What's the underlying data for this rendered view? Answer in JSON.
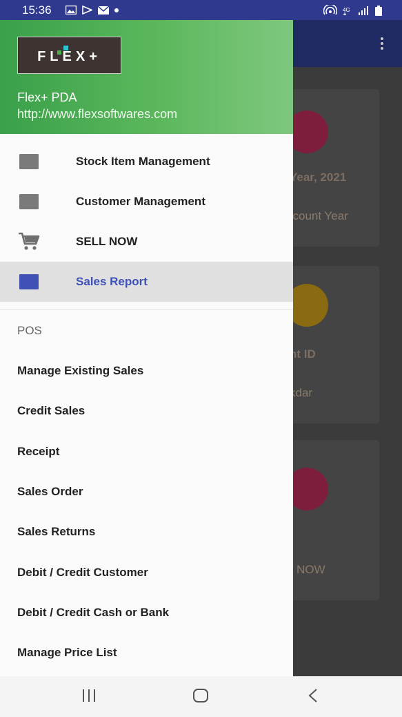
{
  "status_bar": {
    "time": "15:36",
    "left_icons": [
      "gallery-icon",
      "play-store-icon",
      "mail-icon",
      "dot-icon"
    ],
    "right_icons": [
      "hotspot-icon",
      "data-icon",
      "signal-icon",
      "battery-icon"
    ]
  },
  "drawer": {
    "header": {
      "logo_text": "FLEX+",
      "app_name": "Flex+ PDA",
      "url": "http://www.flexsoftwares.com"
    },
    "nav_items": [
      {
        "label": "Stock Item Management",
        "icon": "stock-icon",
        "selected": false
      },
      {
        "label": "Customer Management",
        "icon": "customer-icon",
        "selected": false
      },
      {
        "label": "SELL NOW",
        "icon": "cart-icon",
        "selected": false
      },
      {
        "label": "Sales Report",
        "icon": "report-icon",
        "selected": true
      }
    ],
    "section_title": "POS",
    "pos_items": [
      "Manage Existing Sales",
      "Credit Sales",
      "Receipt",
      "Sales Order",
      "Sales Returns",
      "Debit / Credit Customer",
      "Debit / Credit Cash or Bank",
      "Manage Price List"
    ]
  },
  "background": {
    "card1_title": "Year, 2021",
    "card1_sub": "ccount Year",
    "card2_title": "nt ID",
    "card2_sub": "kdar",
    "card3_label": "NOW"
  },
  "colors": {
    "header_green": "#4caf50",
    "accent_blue": "#3f51b5",
    "status_bar": "#2f3a8f"
  }
}
